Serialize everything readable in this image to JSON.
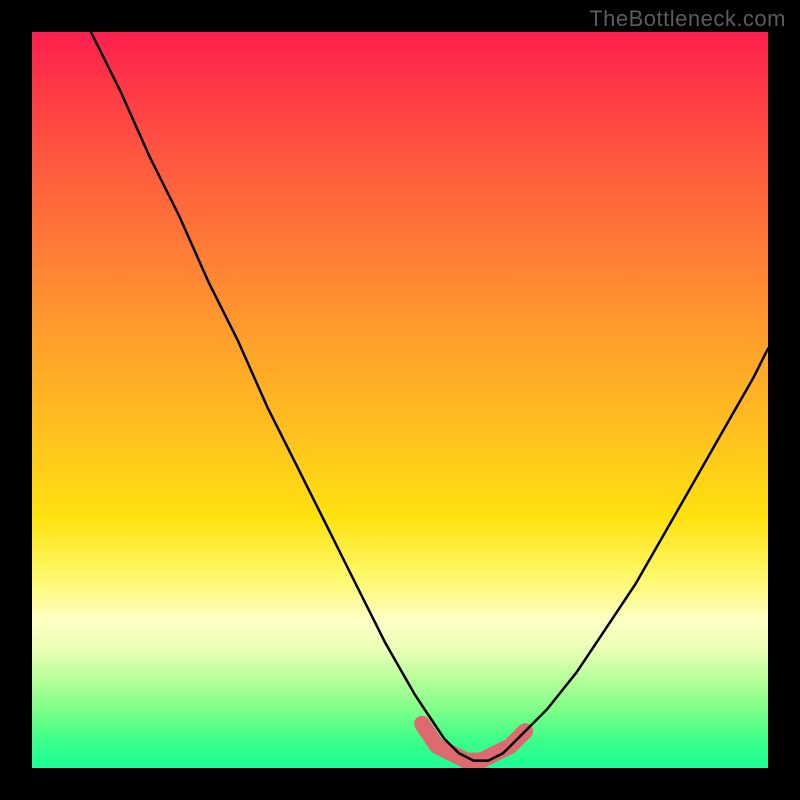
{
  "watermark": "TheBottleneck.com",
  "chart_data": {
    "type": "line",
    "title": "",
    "xlabel": "",
    "ylabel": "",
    "xlim": [
      0,
      100
    ],
    "ylim": [
      0,
      100
    ],
    "grid": false,
    "series": [
      {
        "name": "curve",
        "x": [
          8,
          12,
          16,
          20,
          24,
          28,
          32,
          36,
          40,
          44,
          48,
          52,
          54,
          56,
          58,
          60,
          62,
          64,
          66,
          70,
          74,
          78,
          82,
          86,
          90,
          94,
          98,
          100
        ],
        "values": [
          100,
          92,
          83,
          75,
          66,
          58,
          49,
          41,
          33,
          25,
          17,
          10,
          7,
          4,
          2,
          1,
          1,
          2,
          4,
          8,
          13,
          19,
          25,
          32,
          39,
          46,
          53,
          57
        ]
      }
    ],
    "highlight_region": {
      "x": [
        53,
        55,
        57,
        59,
        61,
        63,
        65,
        67
      ],
      "values": [
        6,
        3,
        2,
        1,
        1,
        2,
        3,
        5
      ]
    },
    "background_gradient": {
      "stops": [
        {
          "pos": 0,
          "color": "#ff1f4f"
        },
        {
          "pos": 18,
          "color": "#ff5a3f"
        },
        {
          "pos": 42,
          "color": "#ffa02b"
        },
        {
          "pos": 66,
          "color": "#ffe210"
        },
        {
          "pos": 80,
          "color": "#fdffc5"
        },
        {
          "pos": 100,
          "color": "#1bff96"
        }
      ]
    }
  }
}
